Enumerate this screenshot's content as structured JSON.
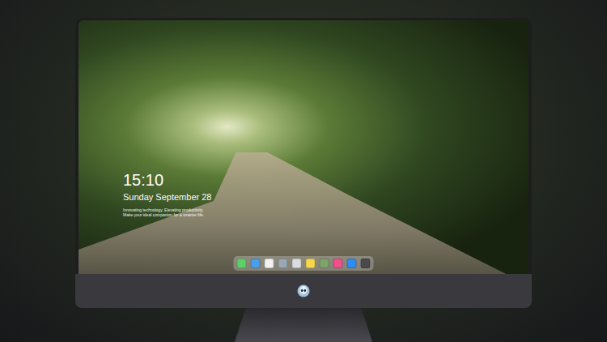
{
  "desktop": {
    "time": "15:10",
    "date": "Sunday September 28",
    "tagline": "Innovating technology. Elevating productivity. Make your ideal companion for a smarter life."
  },
  "dock": {
    "items": [
      {
        "name": "messages",
        "color": "#5fd068"
      },
      {
        "name": "finder",
        "color": "#4a9fe8"
      },
      {
        "name": "clock",
        "color": "#f2f2f2"
      },
      {
        "name": "preview",
        "color": "#9aa7b4"
      },
      {
        "name": "clapper",
        "color": "#d9dde2"
      },
      {
        "name": "notes",
        "color": "#f6d94a"
      },
      {
        "name": "photos",
        "color": "#7fa36a"
      },
      {
        "name": "music",
        "color": "#f0508c"
      },
      {
        "name": "app-store",
        "color": "#2f8cf0"
      },
      {
        "name": "terminal",
        "color": "#4a4a4e"
      }
    ]
  }
}
